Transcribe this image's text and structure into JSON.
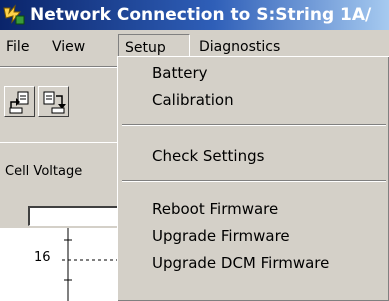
{
  "window": {
    "title": "Network Connection to S:String 1A/"
  },
  "menubar": {
    "items": [
      {
        "label": "File"
      },
      {
        "label": "View"
      },
      {
        "label": "Setup"
      },
      {
        "label": "Diagnostics"
      }
    ]
  },
  "setup_menu": {
    "items": [
      {
        "label": "Battery"
      },
      {
        "label": "Calibration"
      },
      {
        "label": "Check Settings"
      },
      {
        "label": "Reboot Firmware"
      },
      {
        "label": "Upgrade Firmware"
      },
      {
        "label": "Upgrade DCM Firmware"
      }
    ]
  },
  "toolbar": {
    "buttons": [
      {
        "icon": "upload-document-icon"
      },
      {
        "icon": "download-document-icon"
      }
    ]
  },
  "panel": {
    "label": "Cell Voltage",
    "tick_value": "16"
  },
  "colors": {
    "title_bar_start": "#0a246a",
    "title_bar_end": "#a6caf0",
    "window_face": "#d4d0c8"
  }
}
